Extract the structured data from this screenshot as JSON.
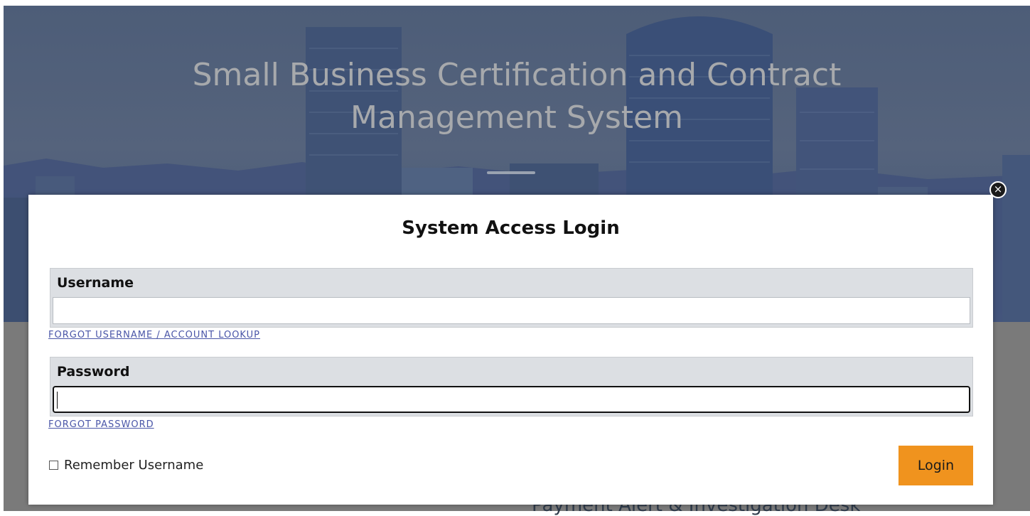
{
  "hero": {
    "title_line1": "Small Business Certification and Contract",
    "title_line2": "Management System"
  },
  "background": {
    "partial_text": "Payment Alert & Investigation Desk"
  },
  "modal": {
    "close_icon": "close-icon",
    "title": "System Access Login",
    "username": {
      "label": "Username",
      "value": "",
      "forgot_link": "FORGOT USERNAME / ACCOUNT LOOKUP"
    },
    "password": {
      "label": "Password",
      "value": "",
      "forgot_link": "FORGOT PASSWORD"
    },
    "remember_label": "Remember Username",
    "remember_checked": false,
    "login_label": "Login"
  },
  "colors": {
    "login_button": "#f0931e",
    "link": "#4a56a8",
    "field_group_bg": "#dcdfe3"
  }
}
